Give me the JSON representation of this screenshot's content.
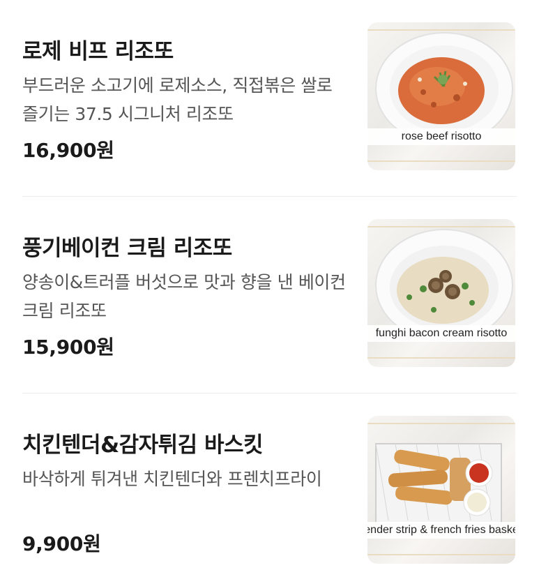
{
  "menu": {
    "items": [
      {
        "title": "로제 비프 리조또",
        "description": "부드러운 소고기에 로제소스, 직접볶은 쌀로 즐기는 37.5 시그니처 리조또",
        "price": "16,900원",
        "image_caption": "rose beef risotto"
      },
      {
        "title": "풍기베이컨 크림 리조또",
        "description": "양송이&트러플 버섯으로 맛과 향을 낸 베이컨 크림 리조또",
        "price": "15,900원",
        "image_caption": "funghi bacon cream risotto"
      },
      {
        "title": "치킨텐더&감자튀김 바스킷",
        "description": "바삭하게 튀겨낸 치킨텐더와 프렌치프라이",
        "price": "9,900원",
        "image_caption": "tender strip & french fries basket"
      }
    ]
  }
}
